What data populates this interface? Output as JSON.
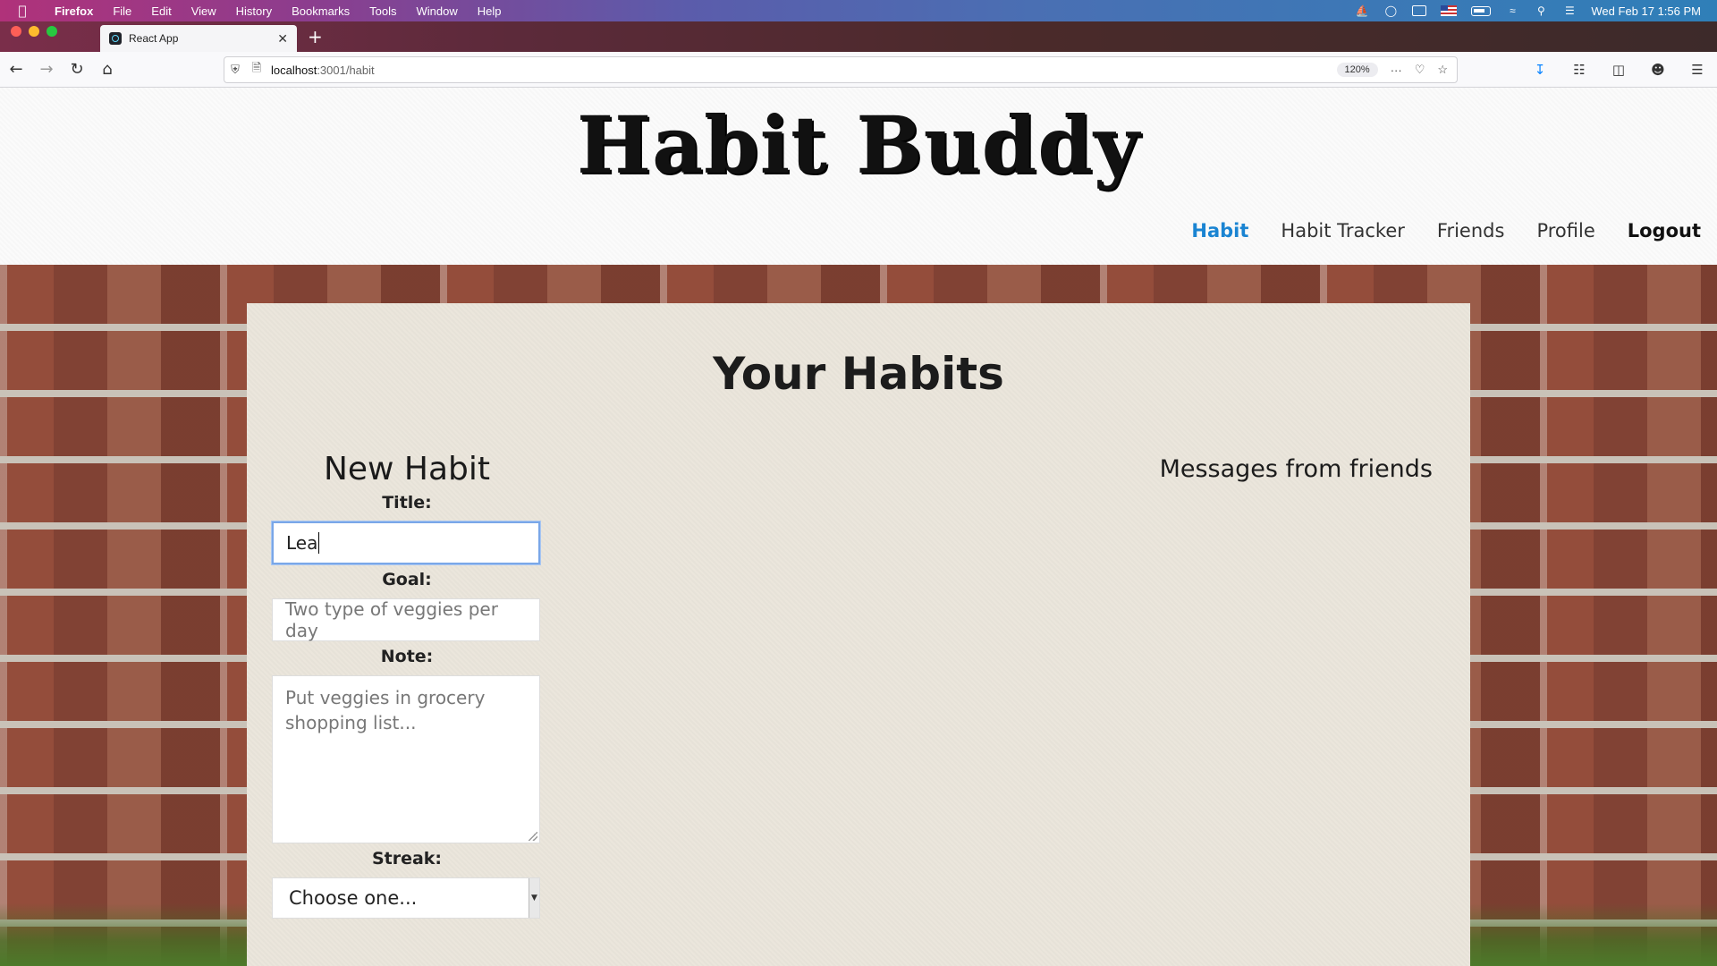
{
  "menubar": {
    "app_name": "Firefox",
    "menus": [
      "File",
      "Edit",
      "View",
      "History",
      "Bookmarks",
      "Tools",
      "Window",
      "Help"
    ],
    "clock": "Wed Feb 17  1:56 PM"
  },
  "browser": {
    "tab_title": "React App",
    "url_host": "localhost",
    "url_path": ":3001/habit",
    "zoom": "120%"
  },
  "site": {
    "title": "Habit Buddy",
    "nav": [
      "Habit",
      "Habit Tracker",
      "Friends",
      "Profile",
      "Logout"
    ],
    "active_nav": "Habit"
  },
  "panel": {
    "title": "Your Habits",
    "new_habit": {
      "heading": "New Habit",
      "title_label": "Title:",
      "title_value": "Lea",
      "goal_label": "Goal:",
      "goal_placeholder": "Two type of veggies per day",
      "note_label": "Note:",
      "note_placeholder": "Put veggies in grocery shopping list...",
      "streak_label": "Streak:",
      "streak_selected": "Choose one..."
    },
    "messages_heading": "Messages from friends"
  },
  "colors": {
    "active_nav": "#1a84d2",
    "panel_bg": "#ebe6dc"
  }
}
